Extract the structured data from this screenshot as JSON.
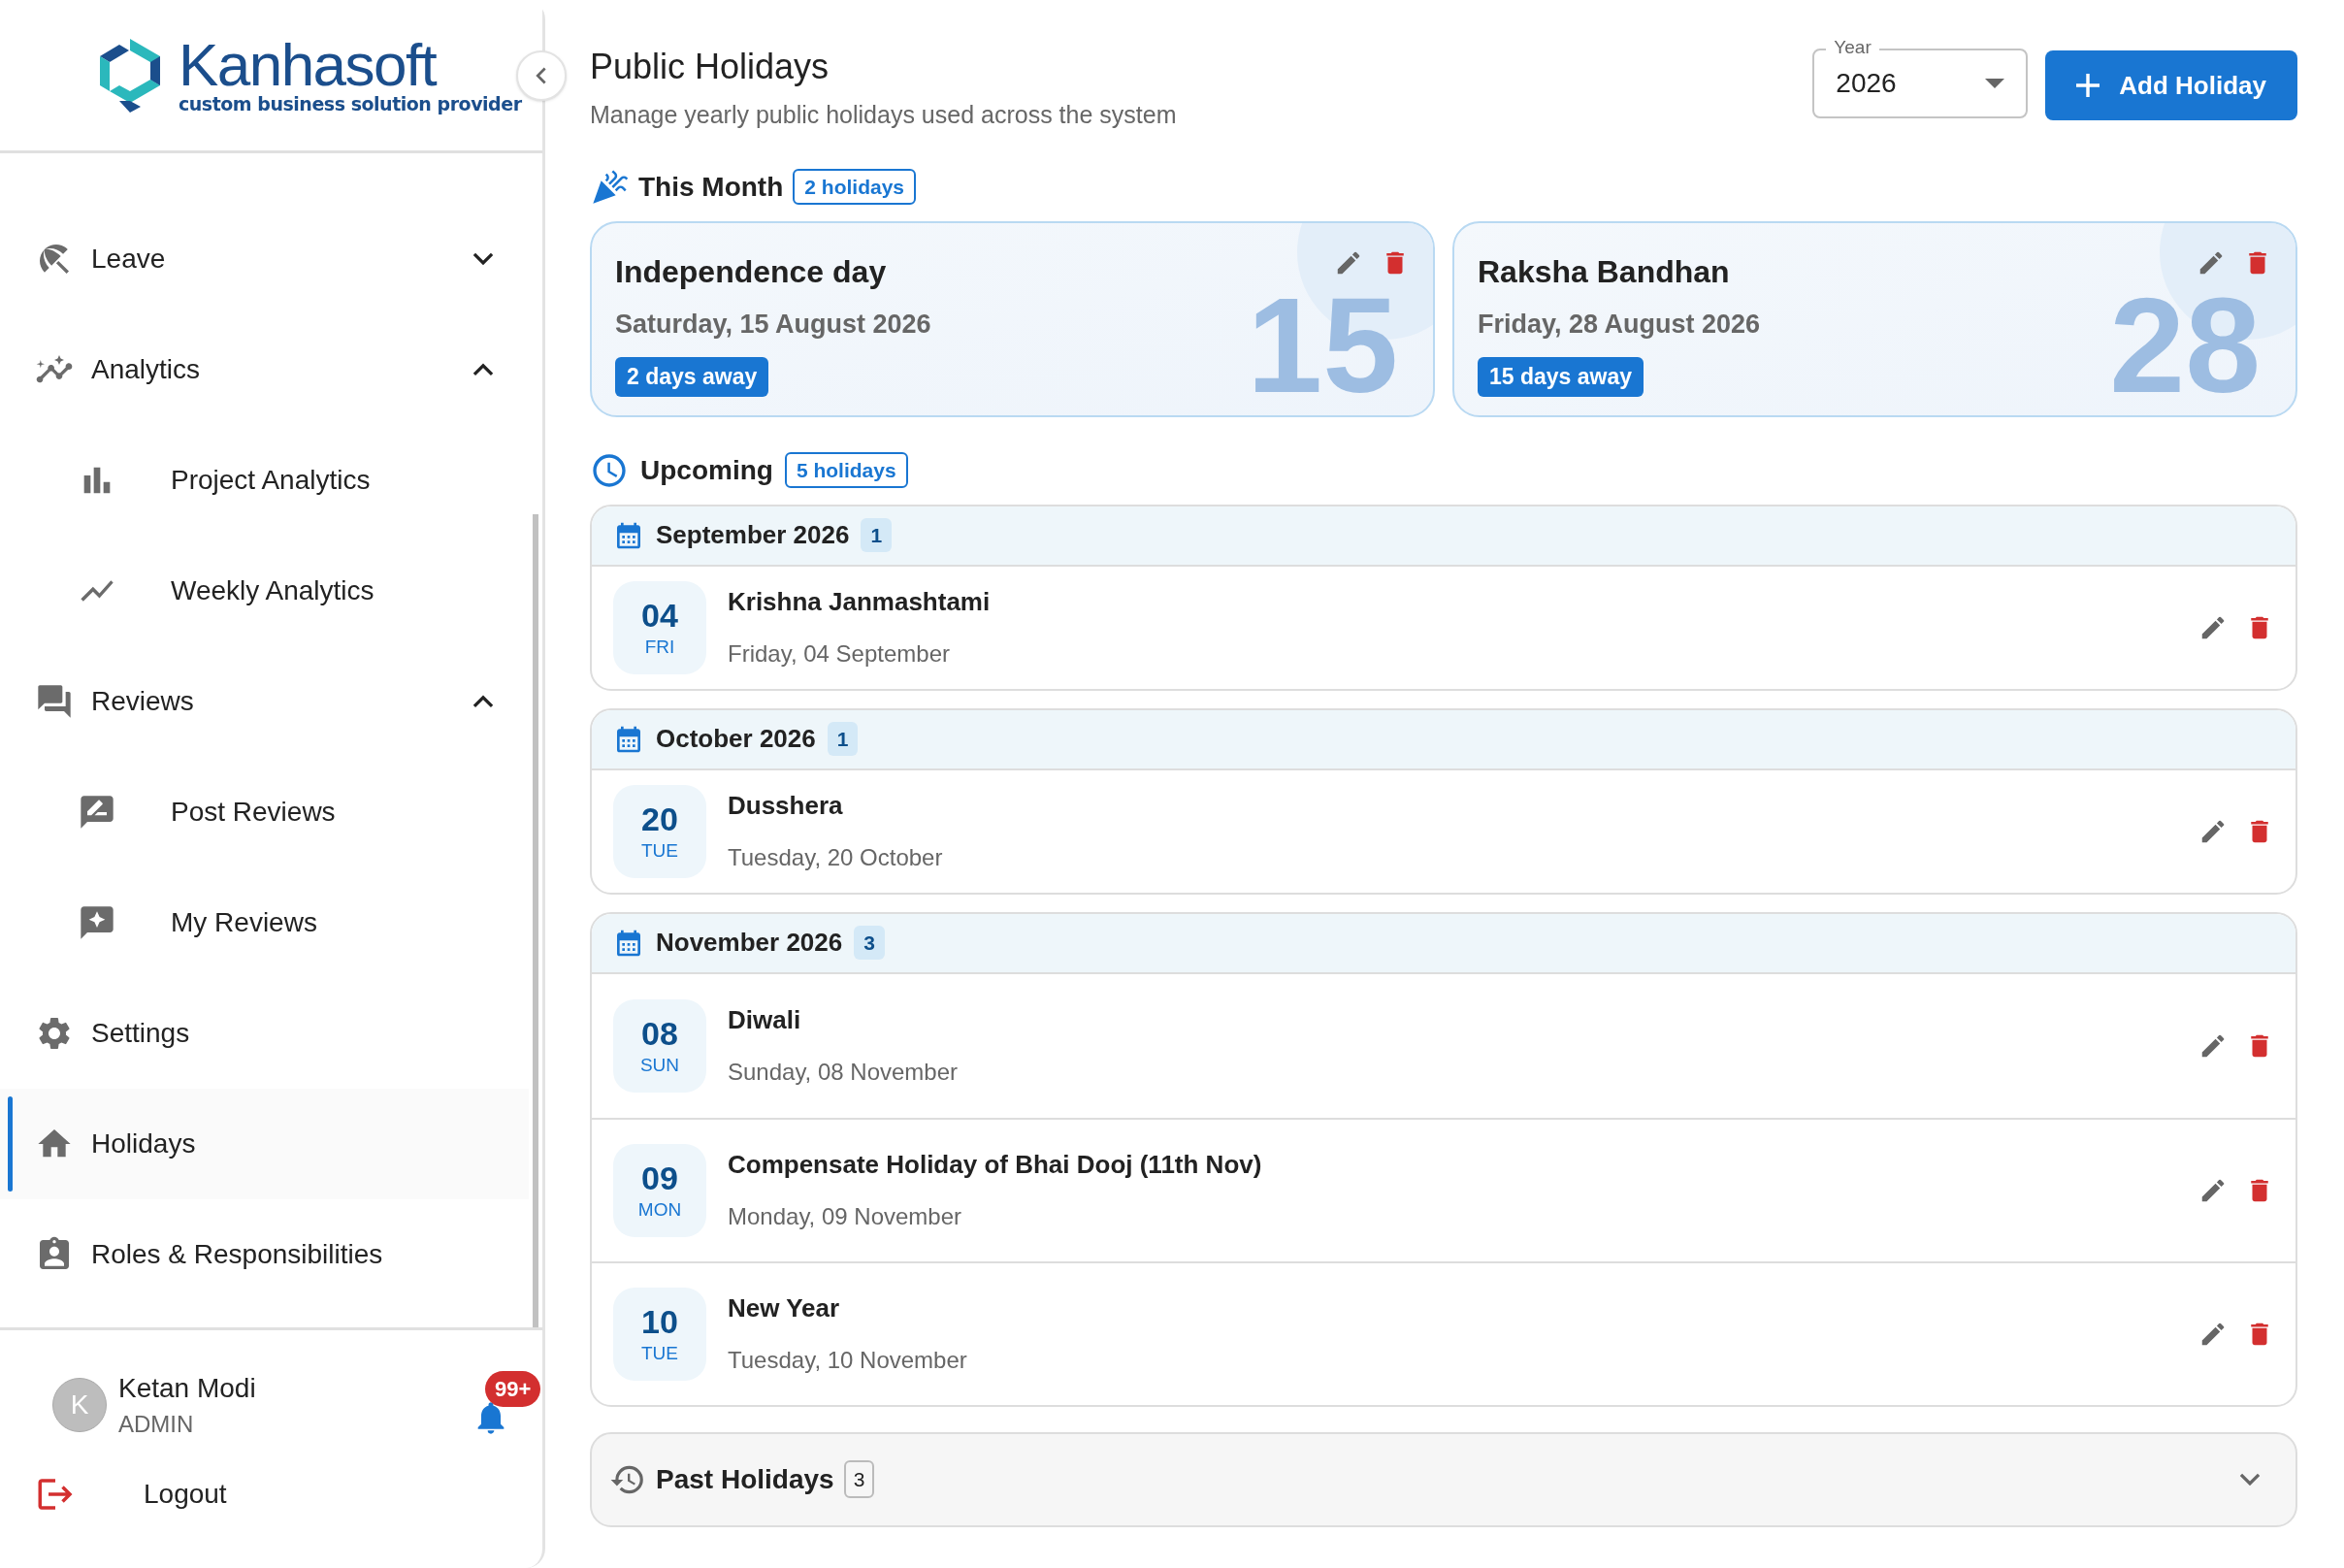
{
  "sidebar": {
    "logo": {
      "name": "Kanhasoft",
      "tagline": "custom business solution provider"
    },
    "items": [
      {
        "label": "Leave",
        "kind": "group",
        "expanded": false,
        "selected": false
      },
      {
        "label": "Analytics",
        "kind": "group",
        "expanded": true,
        "selected": false,
        "children": [
          {
            "label": "Project Analytics",
            "selected": false
          },
          {
            "label": "Weekly Analytics",
            "selected": false
          }
        ]
      },
      {
        "label": "Reviews",
        "kind": "group",
        "expanded": true,
        "selected": false,
        "children": [
          {
            "label": "Post Reviews",
            "selected": false
          },
          {
            "label": "My Reviews",
            "selected": false
          }
        ]
      },
      {
        "label": "Settings",
        "kind": "link",
        "selected": false
      },
      {
        "label": "Holidays",
        "kind": "link",
        "selected": true
      },
      {
        "label": "Roles & Responsibilities",
        "kind": "link",
        "selected": false
      }
    ],
    "user": {
      "initial": "K",
      "name": "Ketan Modi",
      "role": "ADMIN",
      "notifications": "99+"
    },
    "logout": "Logout"
  },
  "header": {
    "title": "Public Holidays",
    "subtitle": "Manage yearly public holidays used across the system",
    "year_select": {
      "label": "Year",
      "value": "2026"
    },
    "add_button": "Add Holiday"
  },
  "this_month": {
    "title": "This Month",
    "count": "2 holidays",
    "cards": [
      {
        "name": "Independence day",
        "date": "Saturday, 15 August 2026",
        "badge": "2 days away",
        "day": "15"
      },
      {
        "name": "Raksha Bandhan",
        "date": "Friday, 28 August 2026",
        "badge": "15 days away",
        "day": "28"
      }
    ]
  },
  "upcoming": {
    "title": "Upcoming",
    "count": "5 holidays",
    "months": [
      {
        "title": "September 2026",
        "count": "1",
        "holidays": [
          {
            "day": "04",
            "weekday": "FRI",
            "name": "Krishna Janmashtami",
            "date": "Friday, 04 September"
          }
        ]
      },
      {
        "title": "October 2026",
        "count": "1",
        "holidays": [
          {
            "day": "20",
            "weekday": "TUE",
            "name": "Dusshera",
            "date": "Tuesday, 20 October"
          }
        ]
      },
      {
        "title": "November 2026",
        "count": "3",
        "holidays": [
          {
            "day": "08",
            "weekday": "SUN",
            "name": "Diwali",
            "date": "Sunday, 08 November"
          },
          {
            "day": "09",
            "weekday": "MON",
            "name": "Compensate Holiday of Bhai Dooj (11th Nov)",
            "date": "Monday, 09 November"
          },
          {
            "day": "10",
            "weekday": "TUE",
            "name": "New Year",
            "date": "Tuesday, 10 November"
          }
        ]
      }
    ]
  },
  "past": {
    "title": "Past Holidays",
    "count": "3",
    "expanded": false
  }
}
